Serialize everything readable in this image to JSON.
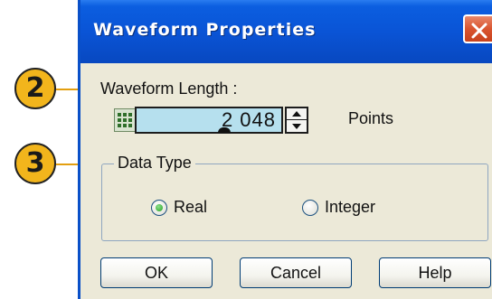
{
  "dialog": {
    "title": "Waveform Properties",
    "waveform_length_label": "Waveform Length :",
    "waveform_length_value": "2 048",
    "units_label": "Points",
    "data_type_label": "Data Type",
    "radio_options": [
      {
        "label": "Real",
        "selected": true
      },
      {
        "label": "Integer",
        "selected": false
      }
    ],
    "buttons": {
      "ok": "OK",
      "cancel": "Cancel",
      "help": "Help"
    }
  },
  "callouts": [
    "2",
    "3"
  ],
  "colors": {
    "titlebar": "#0a54d6",
    "dialog_bg": "#ece9d8",
    "input_bg": "#b6e0ee",
    "close_button": "#d9542f",
    "callout": "#f2b51c"
  },
  "icons": [
    "close-icon",
    "calculator-icon",
    "spin-up-icon",
    "spin-down-icon"
  ]
}
